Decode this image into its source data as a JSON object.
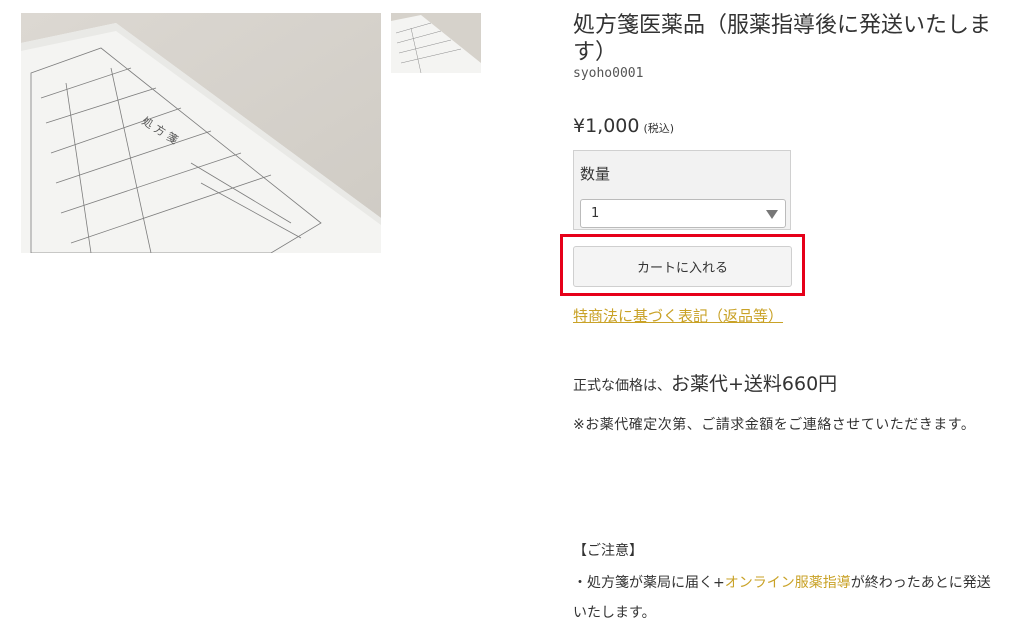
{
  "product": {
    "title": "処方箋医薬品（服薬指導後に発送いたします）",
    "sku": "syoho0001",
    "price": "¥1,000",
    "tax_note": "(税込)"
  },
  "images": {
    "main_alt": "処方箋",
    "form_heading": "処 方 箋"
  },
  "quantity": {
    "label": "数量",
    "selected": "1"
  },
  "cart": {
    "button_label": "カートに入れる"
  },
  "links": {
    "tokusho": "特商法に基づく表記（返品等）"
  },
  "pricing_info": {
    "prefix": "正式な価格は、",
    "emphasis": "お薬代+送料660円",
    "note": "※お薬代確定次第、ご請求金額をご連絡させていただきます。"
  },
  "caution": {
    "heading": "【ご注意】",
    "line_before": "・処方箋が薬局に届く+",
    "link_text": "オンライン服薬指導",
    "line_after": "が終わったあとに発送いたします。"
  },
  "colors": {
    "accent": "#c9a227",
    "highlight": "#e60019"
  }
}
